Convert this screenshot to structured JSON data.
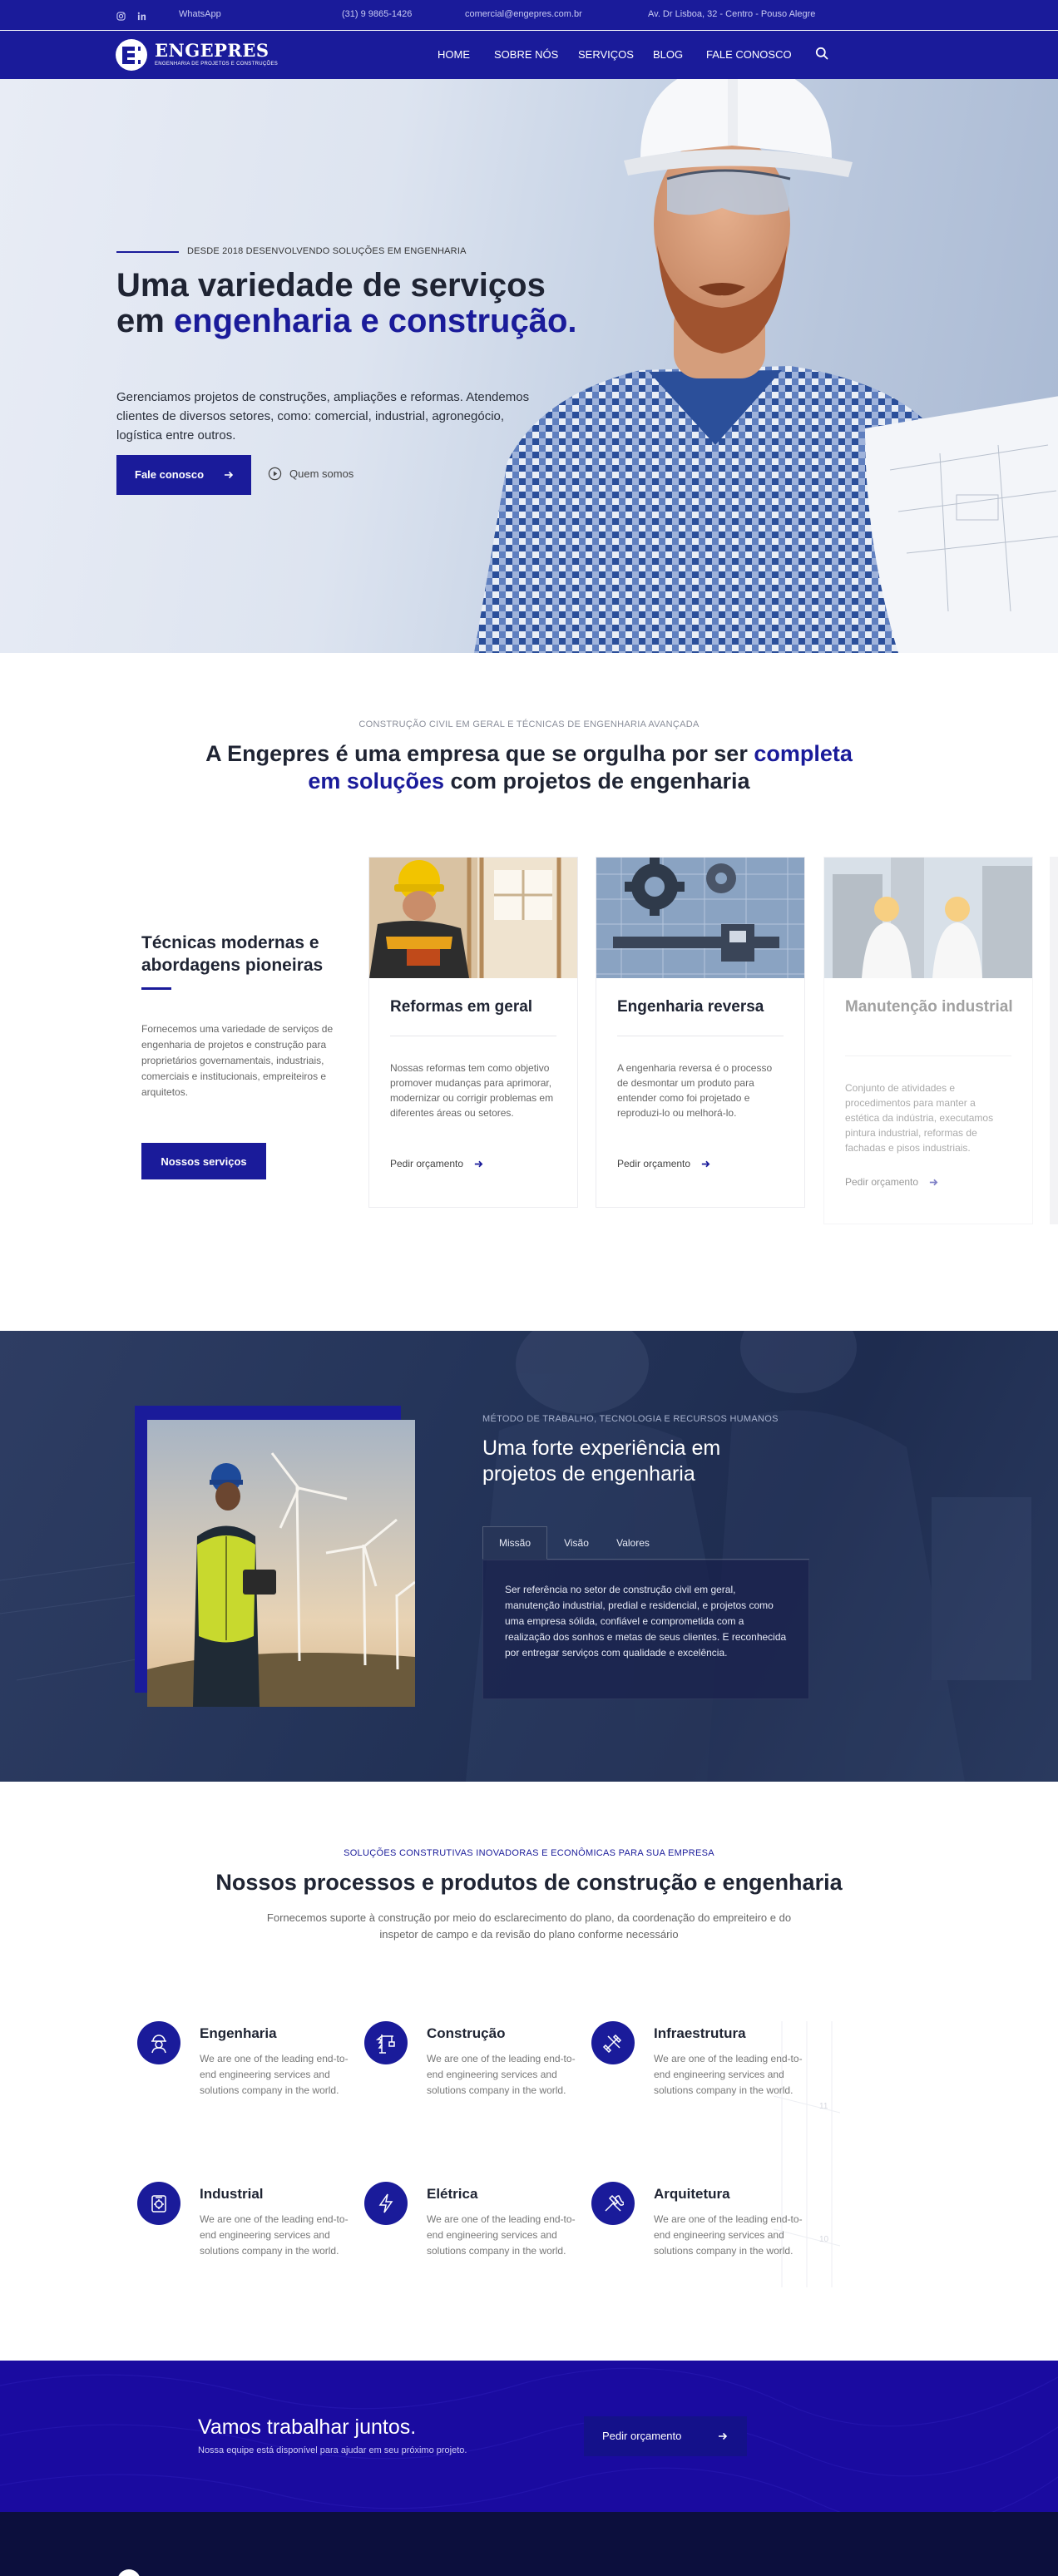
{
  "topbar": {
    "instagram_icon": "instagram-icon",
    "linkedin_icon": "linkedin-icon",
    "whatsapp": "WhatsApp",
    "phone": "(31) 9 9865-1426",
    "email": "comercial@engepres.com.br",
    "address": "Av. Dr Lisboa, 32 - Centro - Pouso Alegre"
  },
  "header": {
    "brand": "ENGEPRES",
    "brand_sub": "ENGENHARIA DE PROJETOS E CONSTRUÇÕES",
    "nav": [
      "HOME",
      "SOBRE NÓS",
      "SERVIÇOS",
      "BLOG",
      "FALE CONOSCO"
    ],
    "search_icon": "search-icon"
  },
  "hero": {
    "eyebrow": "DESDE 2018 DESENVOLVENDO SOLUÇÕES EM ENGENHARIA",
    "title_part1": "Uma variedade de serviços em ",
    "title_highlight": "engenharia e construção.",
    "description": "Gerenciamos projetos de construções, ampliações e reformas. Atendemos clientes de diversos setores, como: comercial, industrial, agronegócio, logística entre outros.",
    "cta_label": "Fale conosco",
    "secondary_label": "Quem somos"
  },
  "intro": {
    "eyebrow": "CONSTRUÇÃO CIVIL EM GERAL E TÉCNICAS DE ENGENHARIA AVANÇADA",
    "title_part1": "A Engepres é uma empresa que se orgulha por ser ",
    "title_highlight": "completa em soluções",
    "title_part2": " com projetos de engenharia"
  },
  "services": {
    "side_title": "Técnicas modernas e abordagens pioneiras",
    "side_description": "Fornecemos uma variedade de serviços de engenharia de projetos e construção para proprietários governamentais, industriais, comerciais e institucionais, empreiteiros e arquitetos.",
    "side_button": "Nossos serviços",
    "cards": [
      {
        "title": "Reformas em geral",
        "description": "Nossas reformas tem como objetivo promover mudanças para aprimorar, modernizar ou corrigir problemas em diferentes áreas ou setores.",
        "link": "Pedir orçamento"
      },
      {
        "title": "Engenharia reversa",
        "description": "A engenharia reversa é o processo de desmontar um produto para entender como foi projetado e reproduzi-lo ou melhorá-lo.",
        "link": "Pedir orçamento"
      },
      {
        "title": "Manutenção industrial",
        "description": "Conjunto de atividades e procedimentos para manter a estética da indústria, executamos pintura industrial, reformas de fachadas e pisos industriais.",
        "link": "Pedir orçamento"
      }
    ]
  },
  "experience": {
    "eyebrow": "MÉTODO DE TRABALHO, TECNOLOGIA E RECURSOS HUMANOS",
    "title": "Uma forte experiência em projetos de engenharia",
    "tabs": [
      "Missão",
      "Visão",
      "Valores"
    ],
    "active_tab": "Missão",
    "panel_text": "Ser referência no setor de construção civil em geral, manutenção industrial, predial e residencial, e projetos como uma empresa sólida, confiável e comprometida com a realização dos sonhos e metas de seus clientes. E reconhecida por entregar serviços com qualidade e excelência."
  },
  "processes": {
    "eyebrow": "SOLUÇÕES CONSTRUTIVAS INOVADORAS E ECONÔMICAS PARA SUA EMPRESA",
    "title": "Nossos processos e produtos de construção e engenharia",
    "description": "Fornecemos suporte à construção por meio do esclarecimento do plano, da coordenação do empreiteiro e do inspetor de campo e da revisão do plano conforme necessário",
    "features": [
      {
        "title": "Engenharia",
        "description": "We are one of the leading end-to-end engineering services and solutions company in the world.",
        "icon": "engineer-icon"
      },
      {
        "title": "Construção",
        "description": "We are one of the leading end-to-end engineering services and solutions company in the world.",
        "icon": "crane-icon"
      },
      {
        "title": "Infraestrutura",
        "description": "We are one of the leading end-to-end engineering services and solutions company in the world.",
        "icon": "tools-icon"
      },
      {
        "title": "Industrial",
        "description": "We are one of the leading end-to-end engineering services and solutions company in the world.",
        "icon": "factory-icon"
      },
      {
        "title": "Elétrica",
        "description": "We are one of the leading end-to-end engineering services and solutions company in the world.",
        "icon": "lightning-icon"
      },
      {
        "title": "Arquitetura",
        "description": "We are one of the leading end-to-end engineering services and solutions company in the world.",
        "icon": "hammer-wrench-icon"
      }
    ]
  },
  "cta": {
    "title": "Vamos trabalhar juntos.",
    "subtitle": "Nossa equipe está disponível para ajudar em seu próximo projeto.",
    "button": "Pedir orçamento"
  },
  "colors": {
    "primary": "#1a1b9a",
    "cta_background": "#1a0ba0",
    "dark_section": "#243459",
    "footer": "#0c0f3d"
  }
}
